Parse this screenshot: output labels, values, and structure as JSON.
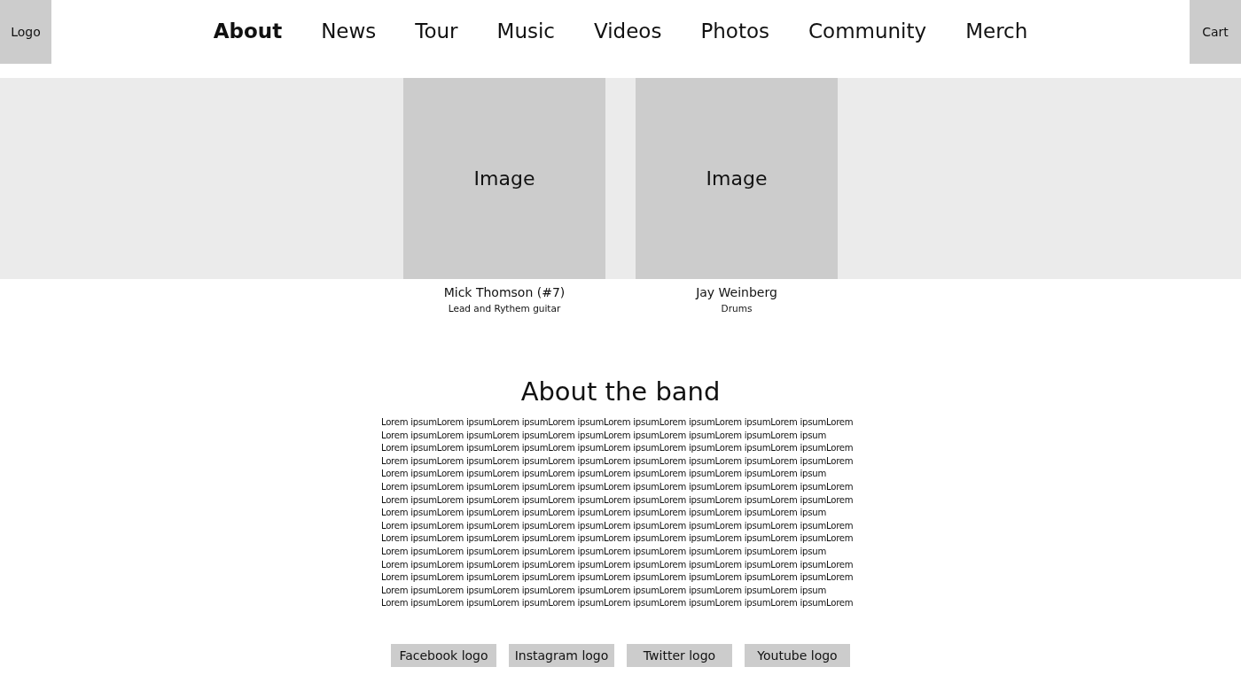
{
  "header": {
    "logo": "Logo",
    "cart": "Cart"
  },
  "nav": [
    {
      "label": "About",
      "selected": true
    },
    {
      "label": "News",
      "selected": false
    },
    {
      "label": "Tour",
      "selected": false
    },
    {
      "label": "Music",
      "selected": false
    },
    {
      "label": "Videos",
      "selected": false
    },
    {
      "label": "Photos",
      "selected": false
    },
    {
      "label": "Community",
      "selected": false
    },
    {
      "label": "Merch",
      "selected": false
    }
  ],
  "members": [
    {
      "image": "Image",
      "name": "Mick Thomson (#7)",
      "role": "Lead and Rythem guitar"
    },
    {
      "image": "Image",
      "name": "Jay Weinberg",
      "role": "Drums"
    }
  ],
  "about": {
    "title": "About the band",
    "lines": [
      "Lorem ipsumLorem ipsumLorem ipsumLorem ipsumLorem ipsumLorem ipsumLorem ipsumLorem ipsumLorem",
      "Lorem ipsumLorem ipsumLorem ipsumLorem ipsumLorem ipsumLorem ipsumLorem ipsumLorem ipsum",
      "Lorem ipsumLorem ipsumLorem ipsumLorem ipsumLorem ipsumLorem ipsumLorem ipsumLorem ipsumLorem",
      "Lorem ipsumLorem ipsumLorem ipsumLorem ipsumLorem ipsumLorem ipsumLorem ipsumLorem ipsumLorem",
      "Lorem ipsumLorem ipsumLorem ipsumLorem ipsumLorem ipsumLorem ipsumLorem ipsumLorem ipsum",
      "Lorem ipsumLorem ipsumLorem ipsumLorem ipsumLorem ipsumLorem ipsumLorem ipsumLorem ipsumLorem",
      "Lorem ipsumLorem ipsumLorem ipsumLorem ipsumLorem ipsumLorem ipsumLorem ipsumLorem ipsumLorem",
      "Lorem ipsumLorem ipsumLorem ipsumLorem ipsumLorem ipsumLorem ipsumLorem ipsumLorem ipsum",
      "Lorem ipsumLorem ipsumLorem ipsumLorem ipsumLorem ipsumLorem ipsumLorem ipsumLorem ipsumLorem",
      "Lorem ipsumLorem ipsumLorem ipsumLorem ipsumLorem ipsumLorem ipsumLorem ipsumLorem ipsumLorem",
      "Lorem ipsumLorem ipsumLorem ipsumLorem ipsumLorem ipsumLorem ipsumLorem ipsumLorem ipsum",
      "Lorem ipsumLorem ipsumLorem ipsumLorem ipsumLorem ipsumLorem ipsumLorem ipsumLorem ipsumLorem",
      "Lorem ipsumLorem ipsumLorem ipsumLorem ipsumLorem ipsumLorem ipsumLorem ipsumLorem ipsumLorem",
      "Lorem ipsumLorem ipsumLorem ipsumLorem ipsumLorem ipsumLorem ipsumLorem ipsumLorem ipsum",
      "Lorem ipsumLorem ipsumLorem ipsumLorem ipsumLorem ipsumLorem ipsumLorem ipsumLorem ipsumLorem"
    ]
  },
  "social": [
    "Facebook logo",
    "Instagram logo",
    "Twitter logo",
    "Youtube logo"
  ]
}
